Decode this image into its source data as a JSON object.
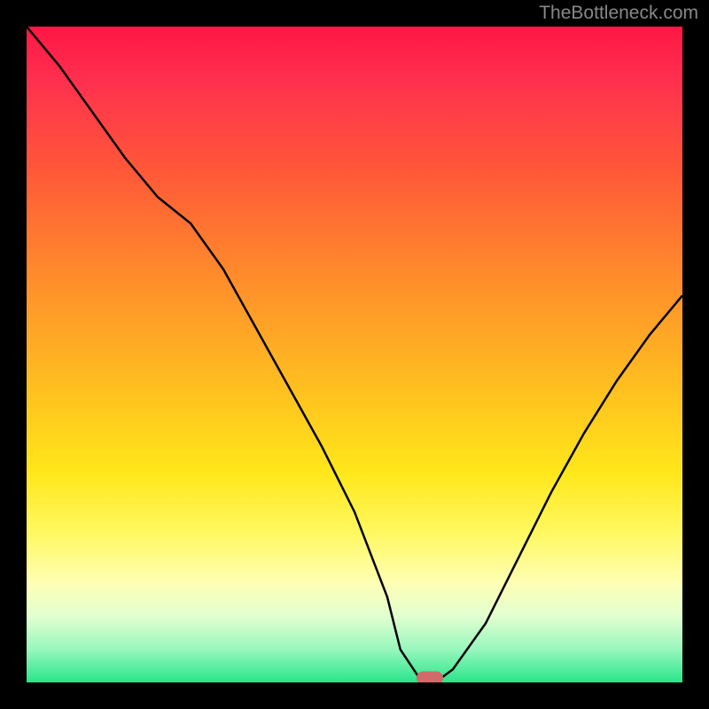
{
  "watermark": "TheBottleneck.com",
  "chart_data": {
    "type": "line",
    "title": "",
    "xlabel": "",
    "ylabel": "",
    "xlim": [
      0,
      100
    ],
    "ylim": [
      0,
      100
    ],
    "grid": false,
    "series": [
      {
        "name": "curve",
        "x": [
          0,
          5,
          10,
          15,
          20,
          25,
          30,
          35,
          40,
          45,
          50,
          55,
          57,
          60,
          63,
          65,
          70,
          75,
          80,
          85,
          90,
          95,
          100
        ],
        "y": [
          100,
          94,
          87,
          80,
          74,
          70,
          63,
          54,
          45,
          36,
          26,
          13,
          5,
          0.5,
          0.5,
          2,
          9,
          19,
          29,
          38,
          46,
          53,
          59
        ]
      }
    ],
    "marker": {
      "x": 61.5,
      "y": 0.7
    },
    "background_gradient": {
      "top": "#ff1744",
      "mid": "#ffe71a",
      "bottom": "#29e58a"
    }
  }
}
